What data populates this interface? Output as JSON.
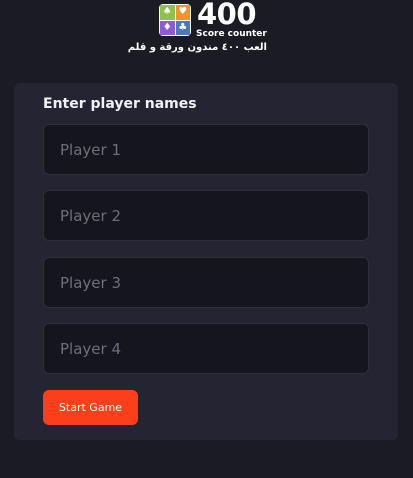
{
  "logo": {
    "number": "400",
    "subtitle": "Score counter",
    "arabic_tagline": "العب ٤٠٠ مندون ورقة و قلم",
    "suits": [
      {
        "icon": "spade-icon",
        "glyph": "♠",
        "color": "#8bc34a"
      },
      {
        "icon": "heart-icon",
        "glyph": "♥",
        "color": "#f0932b"
      },
      {
        "icon": "diamond-icon",
        "glyph": "♦",
        "color": "#8e5bd6"
      },
      {
        "icon": "club-icon",
        "glyph": "♣",
        "color": "#4a7ab8"
      }
    ]
  },
  "form": {
    "heading": "Enter player names",
    "players": [
      {
        "placeholder": "Player 1",
        "value": ""
      },
      {
        "placeholder": "Player 2",
        "value": ""
      },
      {
        "placeholder": "Player 3",
        "value": ""
      },
      {
        "placeholder": "Player 4",
        "value": ""
      }
    ],
    "start_label": "Start Game"
  },
  "colors": {
    "background": "#1b1b24",
    "card": "#252433",
    "input": "#15151d",
    "accent": "#fc3f1b"
  }
}
